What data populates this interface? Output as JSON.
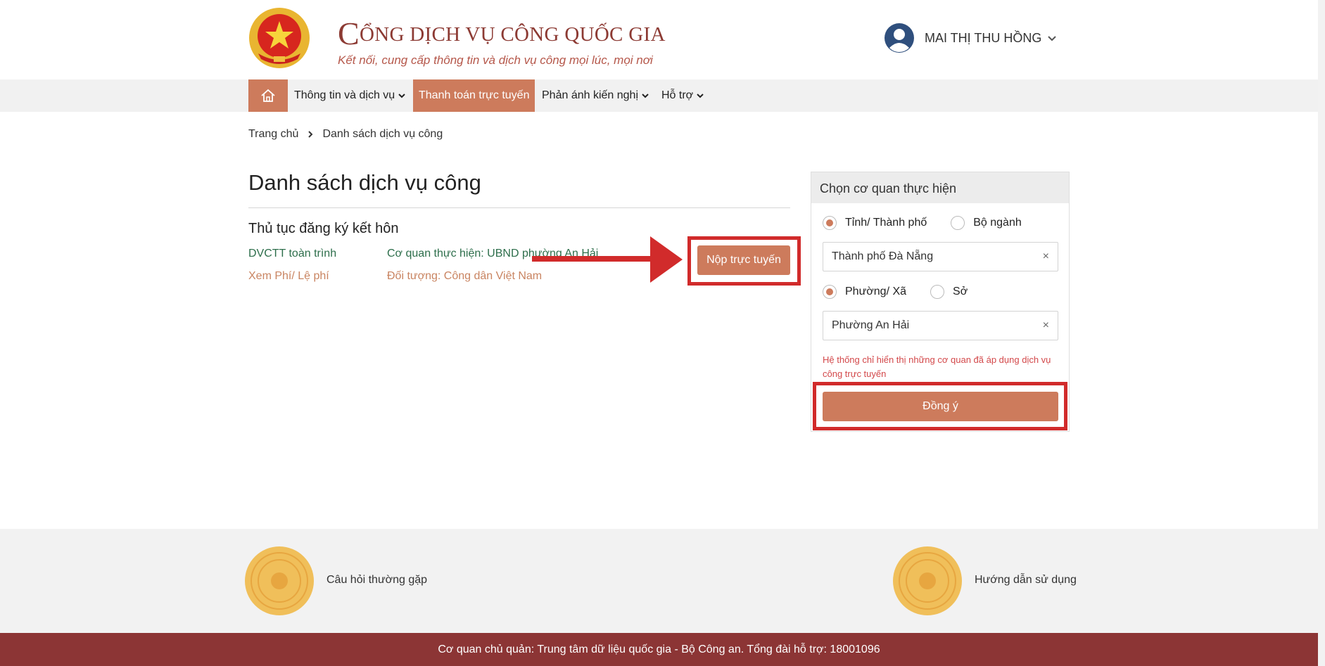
{
  "header": {
    "brand_first_letter": "C",
    "brand_title_rest": "ỔNG DỊCH VỤ CÔNG QUỐC GIA",
    "tagline": "Kết nối, cung cấp thông tin và dịch vụ công mọi lúc, mọi nơi",
    "user_name": "MAI THỊ THU HỒNG"
  },
  "nav": {
    "items": [
      {
        "label": "Thông tin và dịch vụ"
      },
      {
        "label": "Thanh toán trực tuyến"
      },
      {
        "label": "Phản ánh kiến nghị"
      },
      {
        "label": "Hỗ trợ"
      }
    ]
  },
  "breadcrumb": {
    "home": "Trang chủ",
    "current": "Danh sách dịch vụ công"
  },
  "main": {
    "title": "Danh sách dịch vụ công",
    "procedure": {
      "name": "Thủ tục đăng ký kết hôn",
      "level": "DVCTT toàn trình",
      "fees_link": "Xem Phí/ Lệ phí",
      "agency": "Cơ quan thực hiện: UBND phường An Hải",
      "target": "Đối tượng: Công dân Việt Nam",
      "submit_label": "Nộp trực tuyến"
    }
  },
  "panel": {
    "title": "Chọn cơ quan thực hiện",
    "radio1_selected": "Tỉnh/ Thành phố",
    "radio1_other": "Bộ ngành",
    "select1_value": "Thành phố Đà Nẵng",
    "radio2_selected": "Phường/ Xã",
    "radio2_other": "Sở",
    "select2_value": "Phường An Hải",
    "clear_symbol": "×",
    "notice": "Hệ thống chỉ hiển thị những cơ quan đã áp dụng dịch vụ công trực tuyến",
    "agree_label": "Đồng ý"
  },
  "footer": {
    "faq": "Câu hỏi thường gặp",
    "guide": "Hướng dẫn sử dụng",
    "bar_text": "Cơ quan chủ quản: Trung tâm dữ liệu quốc gia - Bộ Công an. Tổng đài hỗ trợ: 18001096"
  },
  "colors": {
    "accent": "#cd7b5c",
    "brand": "#8c3a33",
    "footer_bar": "#8c3535",
    "annotation_red": "#d12b2b"
  },
  "icons": [
    "national-emblem-icon",
    "user-avatar-icon",
    "chevron-down-icon",
    "home-icon",
    "chevron-right-icon",
    "red-arrow-icon",
    "medal-icon"
  ]
}
